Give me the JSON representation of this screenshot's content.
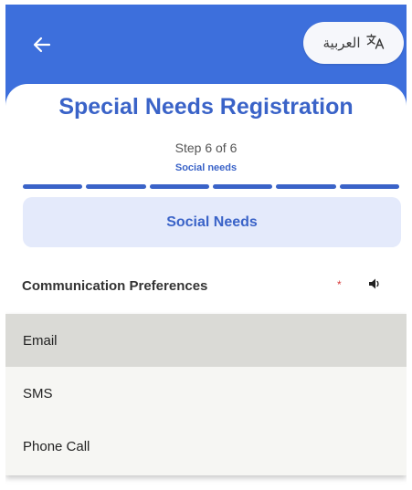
{
  "header": {
    "back_icon": "arrow-left-icon",
    "language_button": {
      "label": "العربية",
      "icon": "translate-icon"
    },
    "color": "#3d6fdc"
  },
  "form": {
    "title": "Special Needs Registration",
    "step": "Step 6 of 6",
    "step_name": "Social needs",
    "progress": {
      "total_steps": 6,
      "current_step": 6
    },
    "section": "Social Needs",
    "accent_color": "#3a63c8"
  },
  "field": {
    "label": "Communication Preferences",
    "required_mark": "*",
    "speaker_icon": "speaker-icon"
  },
  "dropdown": {
    "options": [
      "Email",
      "SMS",
      "Phone Call"
    ],
    "highlighted": "Email"
  }
}
